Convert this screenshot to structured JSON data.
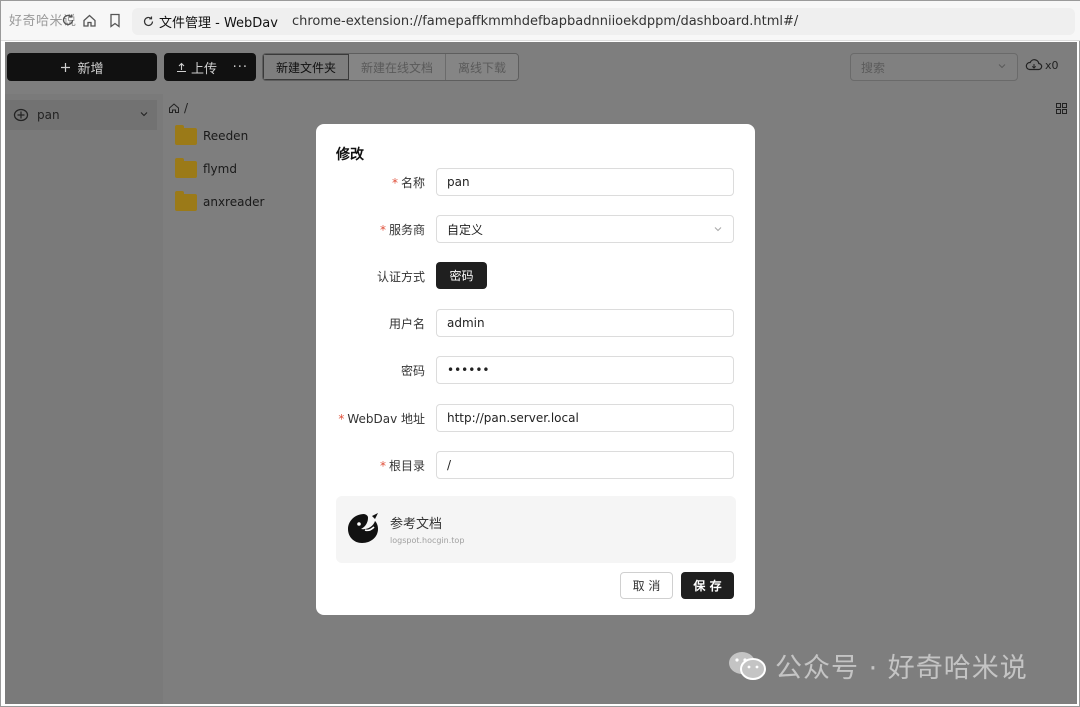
{
  "browser": {
    "watermark_top": "好奇哈米说",
    "site_title": "文件管理 - WebDav",
    "url": "chrome-extension://famepaffkmmhdefbapbadnniioekdppm/dashboard.html#/"
  },
  "topbar": {
    "new_label": "新增",
    "upload_label": "上传",
    "more_label": "···",
    "new_folder_label": "新建文件夹",
    "new_online_doc_label": "新建在线文档",
    "offline_download_label": "离线下载",
    "search_placeholder": "搜索",
    "cloud_count": "x0"
  },
  "sidebar": {
    "items": [
      {
        "label": "pan"
      }
    ]
  },
  "main": {
    "breadcrumb": "/",
    "folders": [
      {
        "name": "Reeden"
      },
      {
        "name": "flymd"
      },
      {
        "name": "anxreader"
      }
    ]
  },
  "modal": {
    "title": "修改",
    "fields": {
      "name": {
        "label": "名称",
        "value": "pan",
        "required": true
      },
      "provider": {
        "label": "服务商",
        "value": "自定义",
        "required": true
      },
      "auth": {
        "label": "认证方式",
        "value": "密码",
        "required": false
      },
      "username": {
        "label": "用户名",
        "value": "admin",
        "required": false
      },
      "password": {
        "label": "密码",
        "value": "••••••",
        "required": false
      },
      "webdav": {
        "label": "WebDav 地址",
        "value": "http://pan.server.local",
        "required": true
      },
      "root": {
        "label": "根目录",
        "value": "/",
        "required": true
      }
    },
    "required_mark": "*",
    "reference": {
      "title": "参考文档",
      "subtitle": "logspot.hocgin.top"
    },
    "cancel_label": "取 消",
    "save_label": "保 存"
  },
  "watermark": {
    "text": "公众号 · 好奇哈米说"
  },
  "colors": {
    "accent": "#1f1f1f",
    "required": "#e0503a",
    "overlay": "#7e7e7e",
    "folder": "#9b7a18"
  }
}
